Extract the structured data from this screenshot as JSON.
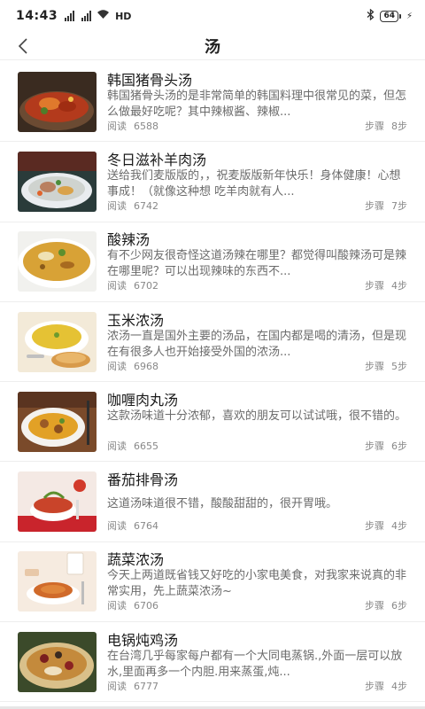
{
  "status_bar": {
    "time": "14:43",
    "signal_label": "HD",
    "battery": "64"
  },
  "nav": {
    "title": "汤"
  },
  "recipes": [
    {
      "title": "韩国猪骨头汤",
      "desc": "韩国猪骨头汤的是非常简单的韩国料理中很常见的菜，但怎么做最好吃呢？其中辣椒酱、辣椒...",
      "read_label": "阅读",
      "read_count": "6588",
      "steps_label": "步骤",
      "steps": "8步"
    },
    {
      "title": "冬日滋补羊肉汤",
      "desc": "送给我们麦版版的，，祝麦版版新年快乐！身体健康！心想事成！（就像这种想 吃羊肉就有人...",
      "read_label": "阅读",
      "read_count": "6742",
      "steps_label": "步骤",
      "steps": "7步"
    },
    {
      "title": "酸辣汤",
      "desc": "有不少网友很奇怪这道汤辣在哪里？都觉得叫酸辣汤可是辣在哪里呢？可以出现辣味的东西不...",
      "read_label": "阅读",
      "read_count": "6702",
      "steps_label": "步骤",
      "steps": "4步"
    },
    {
      "title": "玉米浓汤",
      "desc": "浓汤一直是国外主要的汤品，在国内都是喝的清汤，但是现在有很多人也开始接受外国的浓汤...",
      "read_label": "阅读",
      "read_count": "6968",
      "steps_label": "步骤",
      "steps": "5步"
    },
    {
      "title": "咖喱肉丸汤",
      "desc": "这款汤味道十分浓郁，喜欢的朋友可以试试哦，很不错的。",
      "read_label": "阅读",
      "read_count": "6655",
      "steps_label": "步骤",
      "steps": "6步"
    },
    {
      "title": "番茄排骨汤",
      "desc": "这道汤味道很不错，酸酸甜甜的，很开胃哦。",
      "read_label": "阅读",
      "read_count": "6764",
      "steps_label": "步骤",
      "steps": "4步"
    },
    {
      "title": "蔬菜浓汤",
      "desc": "今天上两道既省钱又好吃的小家电美食，对我家来说真的非常实用，先上蔬菜浓汤~",
      "read_label": "阅读",
      "read_count": "6706",
      "steps_label": "步骤",
      "steps": "6步"
    },
    {
      "title": "电锅炖鸡汤",
      "desc": "在台湾几乎每家每户都有一个大同电蒸锅.,外面一层可以放水,里面再多一个内胆.用来蒸蛋,炖...",
      "read_label": "阅读",
      "read_count": "6777",
      "steps_label": "步骤",
      "steps": "4步"
    }
  ]
}
